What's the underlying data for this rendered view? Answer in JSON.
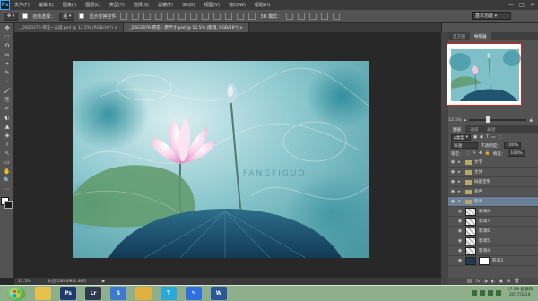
{
  "menubar": {
    "logo": "Ps",
    "items": [
      "文件(F)",
      "编辑(E)",
      "图像(I)",
      "图层(L)",
      "类型(Y)",
      "选择(S)",
      "滤镜(T)",
      "3D(D)",
      "视图(V)",
      "窗口(W)",
      "帮助(H)"
    ],
    "window_controls": [
      "—",
      "□",
      "✕"
    ]
  },
  "options_bar": {
    "auto_select_label": "自动选择：",
    "auto_select_value": "组",
    "show_transform_label": "显示变换控件",
    "mode_label": "3D 模式："
  },
  "workspace_select": "基本功能",
  "tabs": [
    {
      "label": "_DSC0376-荷花~去燥.psd @ 12.5% (RGB/16*) ×",
      "active": false
    },
    {
      "label": "_DSC0376-荷花 - 原尺寸.psd @ 12.5% (影调, RGB/16*) ×",
      "active": true
    }
  ],
  "tools": [
    "✥",
    "⬚",
    "ʘ",
    "✂",
    "⌗",
    "✎",
    "⌁",
    "🖌",
    "⎘",
    "✐",
    "◐",
    "▲",
    "◈",
    "T",
    "↖",
    "▭",
    "✋",
    "🔍",
    "⋯"
  ],
  "status": {
    "zoom": "12.5%",
    "doc_info": "文档:136.4M/2.48G",
    "arrow": "▶"
  },
  "photo": {
    "watermark": "FANGYIGUO"
  },
  "right_panels": {
    "nav_tabs": [
      "直方图",
      "导航器"
    ],
    "nav_zoom": "12.5%",
    "layers_tabs": [
      "图层",
      "通道",
      "路径"
    ],
    "kind_label": "ρ类型",
    "blend_mode": "穿透",
    "opacity_label": "不透明度：",
    "opacity_value": "100%",
    "lock_label": "锁定：",
    "fill_label": "填充：",
    "fill_value": "100%",
    "layers": [
      {
        "name": "文字",
        "kind": "folder",
        "selected": false
      },
      {
        "name": "主体",
        "kind": "folder",
        "selected": false
      },
      {
        "name": "局部定制",
        "kind": "folder",
        "selected": false
      },
      {
        "name": "背色",
        "kind": "folder",
        "selected": false
      },
      {
        "name": "影调",
        "kind": "folder-open",
        "selected": true
      },
      {
        "name": "影调8",
        "kind": "layer",
        "selected": false
      },
      {
        "name": "影调7",
        "kind": "layer",
        "selected": false
      },
      {
        "name": "影调6",
        "kind": "layer",
        "selected": false
      },
      {
        "name": "影调5",
        "kind": "layer",
        "selected": false
      },
      {
        "name": "影调4",
        "kind": "layer",
        "selected": false
      },
      {
        "name": "影调3",
        "kind": "layer-mask",
        "selected": false
      }
    ],
    "footer_icons": [
      "⛓",
      "fx",
      "◑",
      "◐",
      "▣",
      "⊞",
      "🗑"
    ]
  },
  "taskbar": {
    "apps": [
      {
        "name": "explorer",
        "label": "",
        "color": "#e8c14a"
      },
      {
        "name": "photoshop",
        "label": "Ps",
        "color": "#1e3a70"
      },
      {
        "name": "lightroom",
        "label": "Lr",
        "color": "#2d3a4e"
      },
      {
        "name": "sogou",
        "label": "S",
        "color": "#3a7ad0"
      },
      {
        "name": "explorer-folder",
        "label": "",
        "color": "#e0b040"
      },
      {
        "name": "typora",
        "label": "T",
        "color": "#2aa8d8"
      },
      {
        "name": "feishu",
        "label": "✎",
        "color": "#2f6fe0"
      },
      {
        "name": "word",
        "label": "W",
        "color": "#2b579a"
      }
    ],
    "time": "17:39 星期四",
    "date": "2017/2/14",
    "taskbar_color": "#8fae8c"
  }
}
